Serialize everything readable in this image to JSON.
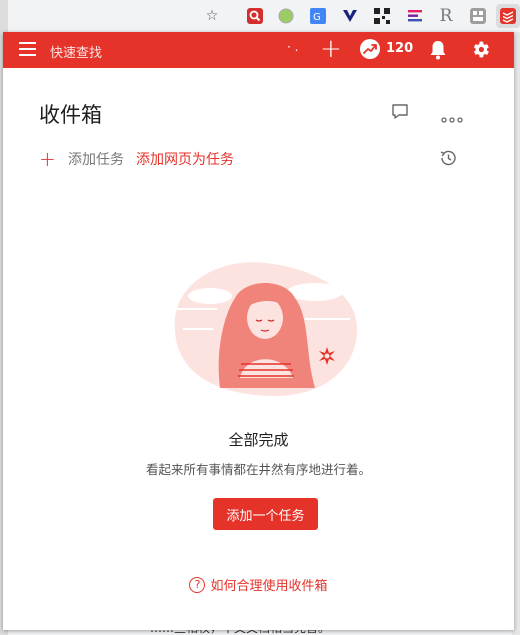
{
  "browser": {
    "extension_icons": [
      "star-icon",
      "search-ext-icon",
      "circle-ext-icon",
      "translate-ext-icon",
      "vpn-ext-icon",
      "qr-ext-icon",
      "list-ext-icon",
      "r-ext-icon",
      "grid-ext-icon",
      "todoist-ext-icon"
    ],
    "r_ext_glyph": "R",
    "bottom_peek_text": "……些相权，中文文档相当完善。"
  },
  "topbar": {
    "search_label": "快速查找",
    "dots_glyph": "·  .",
    "add_glyph": "+",
    "karma_count": "120",
    "background": "#e5332a"
  },
  "page": {
    "title": "收件箱",
    "add_plus": "+",
    "add_task_label": "添加任务",
    "add_web_label": "添加网页为任务"
  },
  "empty_state": {
    "title": "全部完成",
    "subtitle": "看起来所有事情都在井然有序地进行着。",
    "button_label": "添加一个任务",
    "help_icon_glyph": "?",
    "help_label": "如何合理使用收件箱"
  },
  "colors": {
    "accent": "#e5332a",
    "illustration_light": "#fbd6d2",
    "illustration_mid": "#f0837a"
  }
}
